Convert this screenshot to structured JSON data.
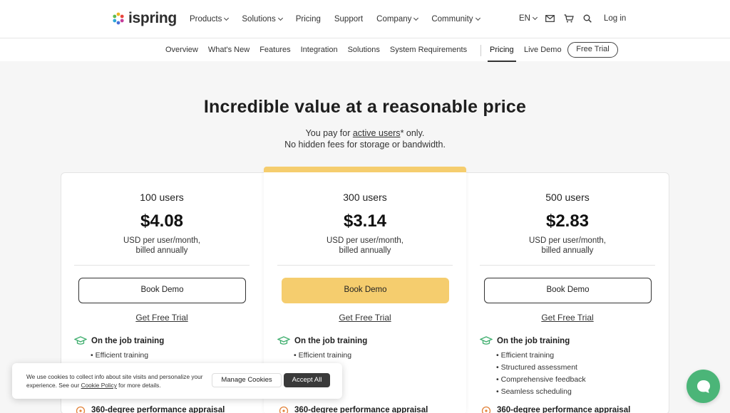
{
  "brand": {
    "name": "ispring"
  },
  "nav": {
    "items": [
      {
        "label": "Products",
        "dropdown": true
      },
      {
        "label": "Solutions",
        "dropdown": true
      },
      {
        "label": "Pricing",
        "dropdown": false
      },
      {
        "label": "Support",
        "dropdown": false
      },
      {
        "label": "Company",
        "dropdown": true
      },
      {
        "label": "Community",
        "dropdown": true
      }
    ],
    "language": "EN",
    "login": "Log in"
  },
  "subnav": {
    "items": [
      "Overview",
      "What's New",
      "Features",
      "Integration",
      "Solutions",
      "System Requirements"
    ],
    "active": "Pricing",
    "live_demo": "Live Demo",
    "free_trial": "Free Trial"
  },
  "hero": {
    "title": "Incredible value at a reasonable price",
    "sub_pre": "You pay for ",
    "sub_link": "active users",
    "sub_post": "* only.",
    "sub_line2": "No hidden fees for storage or bandwidth."
  },
  "plans": [
    {
      "users": "100 users",
      "price": "$4.08",
      "billing_1": "USD per user/month,",
      "billing_2": "billed annually",
      "cta": "Book Demo",
      "trial": "Get Free Trial",
      "feature_title": "On the job training",
      "features": [
        "Efficient training"
      ],
      "feature_title_2": "360-degree performance appraisal"
    },
    {
      "users": "300 users",
      "price": "$3.14",
      "billing_1": "USD per user/month,",
      "billing_2": "billed annually",
      "cta": "Book Demo",
      "trial": "Get Free Trial",
      "feature_title": "On the job training",
      "features": [
        "Efficient training",
        "ssessment",
        "ive feedback",
        "heduling"
      ],
      "feature_title_2": "360-degree performance appraisal"
    },
    {
      "users": "500 users",
      "price": "$2.83",
      "billing_1": "USD per user/month,",
      "billing_2": "billed annually",
      "cta": "Book Demo",
      "trial": "Get Free Trial",
      "feature_title": "On the job training",
      "features": [
        "Efficient training",
        "Structured assessment",
        "Comprehensive feedback",
        "Seamless scheduling"
      ],
      "feature_title_2": "360-degree performance appraisal"
    }
  ],
  "cookie": {
    "text_1": "We use cookies to collect info about site visits and personalize your experience. See our ",
    "policy_link": "Cookie Policy",
    "text_2": " for more details.",
    "manage": "Manage Cookies",
    "accept": "Accept All"
  },
  "colors": {
    "accent": "#f5cd6e",
    "chat": "#4bb578",
    "feature_icon": "#3fae6e",
    "appraisal_icon": "#e2833a"
  }
}
